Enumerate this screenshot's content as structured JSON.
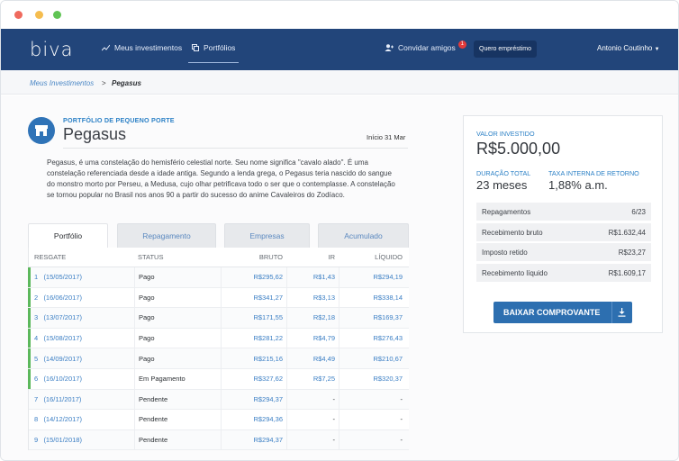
{
  "nav": {
    "logo": "biva",
    "items": [
      {
        "label": "Meus investimentos",
        "icon": "chart-icon"
      },
      {
        "label": "Portfólios",
        "icon": "copy-icon"
      }
    ],
    "invite_label": "Convidar amigos",
    "invite_badge": "1",
    "loan_button": "Quero empréstimo",
    "user_name": "Antonio Coutinho"
  },
  "breadcrumb": {
    "parent": "Meus Investimentos",
    "sep": ">",
    "current": "Pegasus"
  },
  "portfolio": {
    "kicker": "PORTFÓLIO DE PEQUENO PORTE",
    "title": "Pegasus",
    "since": "Início 31 Mar",
    "description": "Pegasus, é uma constelação do hemisfério celestial norte. Seu nome significa \"cavalo alado\". É uma constelação referenciada desde a idade antiga. Segundo a lenda grega, o Pegasus teria nascido do sangue do monstro morto por Perseu, a Medusa, cujo olhar petrificava todo o ser que o contemplasse. A constelação se tornou popular no Brasil nos anos 90 a partir do sucesso do anime Cavaleiros do Zodíaco."
  },
  "tabs": [
    "Portfólio",
    "Repagamento",
    "Empresas",
    "Acumulado"
  ],
  "table": {
    "headers": {
      "resgate": "RESGATE",
      "status": "STATUS",
      "bruto": "BRUTO",
      "ir": "IR",
      "liquido": "LÍQUIDO"
    },
    "rows": [
      {
        "idx": "1",
        "date": "(15/05/2017)",
        "status": "Pago",
        "bruto": "R$295,62",
        "ir": "R$1,43",
        "liquido": "R$294,19"
      },
      {
        "idx": "2",
        "date": "(16/06/2017)",
        "status": "Pago",
        "bruto": "R$341,27",
        "ir": "R$3,13",
        "liquido": "R$338,14"
      },
      {
        "idx": "3",
        "date": "(13/07/2017)",
        "status": "Pago",
        "bruto": "R$171,55",
        "ir": "R$2,18",
        "liquido": "R$169,37"
      },
      {
        "idx": "4",
        "date": "(15/08/2017)",
        "status": "Pago",
        "bruto": "R$281,22",
        "ir": "R$4,79",
        "liquido": "R$276,43"
      },
      {
        "idx": "5",
        "date": "(14/09/2017)",
        "status": "Pago",
        "bruto": "R$215,16",
        "ir": "R$4,49",
        "liquido": "R$210,67"
      },
      {
        "idx": "6",
        "date": "(16/10/2017)",
        "status": "Em Pagamento",
        "bruto": "R$327,62",
        "ir": "R$7,25",
        "liquido": "R$320,37"
      },
      {
        "idx": "7",
        "date": "(16/11/2017)",
        "status": "Pendente",
        "bruto": "R$294,37",
        "ir": "-",
        "liquido": "-"
      },
      {
        "idx": "8",
        "date": "(14/12/2017)",
        "status": "Pendente",
        "bruto": "R$294,36",
        "ir": "-",
        "liquido": "-"
      },
      {
        "idx": "9",
        "date": "(15/01/2018)",
        "status": "Pendente",
        "bruto": "R$294,37",
        "ir": "-",
        "liquido": "-"
      }
    ]
  },
  "summary": {
    "invested_label": "VALOR INVESTIDO",
    "invested_value": "R$5.000,00",
    "duration_label": "DURAÇÃO TOTAL",
    "duration_value": "23 meses",
    "irr_label": "TAXA INTERNA DE RETORNO",
    "irr_value": "1,88% a.m.",
    "stats": [
      {
        "label": "Repagamentos",
        "value": "6/23"
      },
      {
        "label": "Recebimento bruto",
        "value": "R$1.632,44"
      },
      {
        "label": "Imposto retido",
        "value": "R$23,27"
      },
      {
        "label": "Recebimento líquido",
        "value": "R$1.609,17"
      }
    ],
    "download_button": "BAIXAR COMPROVANTE"
  }
}
